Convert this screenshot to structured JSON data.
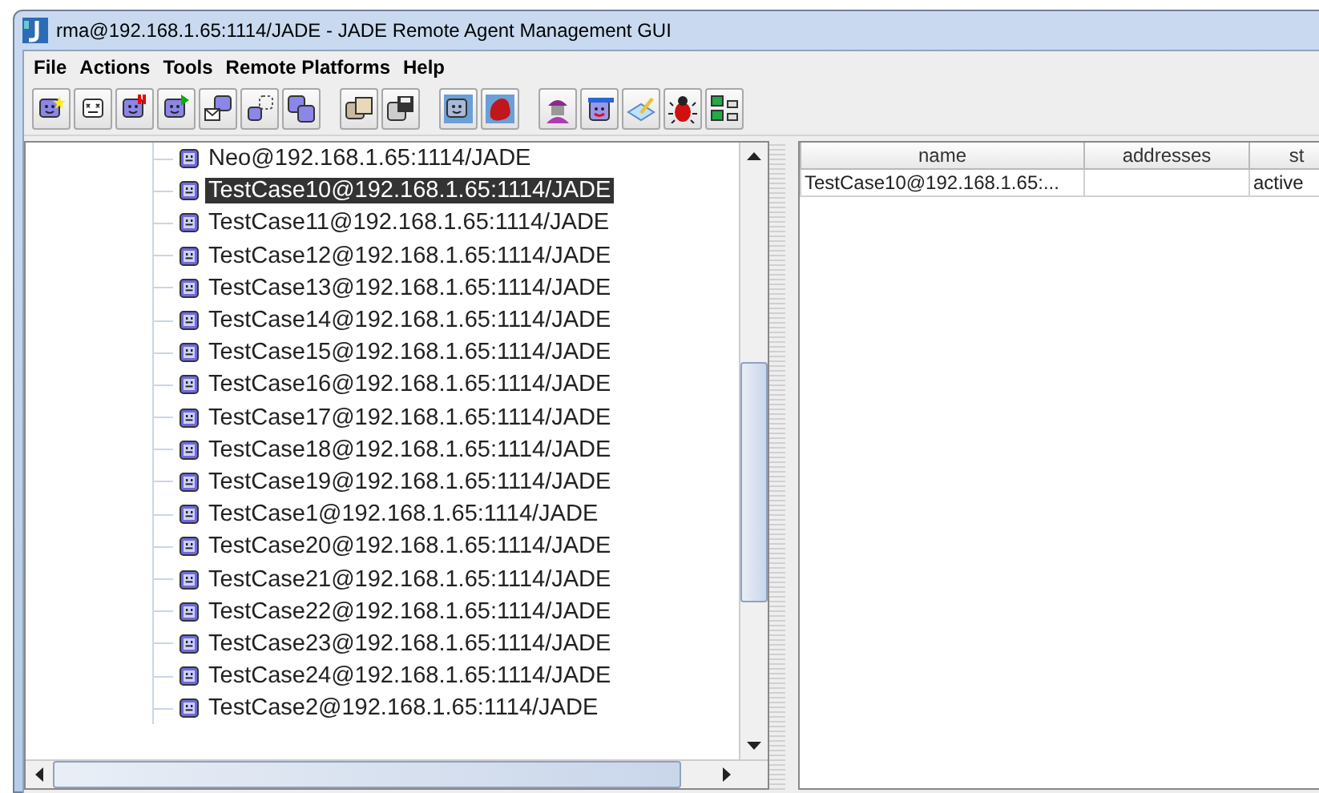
{
  "window": {
    "title": "rma@192.168.1.65:1114/JADE - JADE Remote Agent Management GUI"
  },
  "menu": [
    "File",
    "Actions",
    "Tools",
    "Remote Platforms",
    "Help"
  ],
  "toolbar": [
    [
      {
        "kind": "face-star"
      },
      {
        "kind": "face-dead"
      },
      {
        "kind": "face-pause"
      },
      {
        "kind": "face-play"
      },
      {
        "kind": "face-envelope"
      },
      {
        "kind": "face-dotted"
      },
      {
        "kind": "face-pair"
      }
    ],
    [
      {
        "kind": "faces-folder"
      },
      {
        "kind": "faces-disk"
      }
    ],
    [
      {
        "kind": "face-blue"
      },
      {
        "kind": "red-blob"
      }
    ],
    [
      {
        "kind": "spy"
      },
      {
        "kind": "face-cap"
      },
      {
        "kind": "notepad"
      },
      {
        "kind": "bug"
      },
      {
        "kind": "computers"
      }
    ]
  ],
  "tree": {
    "items": [
      {
        "label": "Neo@192.168.1.65:1114/JADE",
        "selected": false
      },
      {
        "label": "TestCase10@192.168.1.65:1114/JADE",
        "selected": true
      },
      {
        "label": "TestCase11@192.168.1.65:1114/JADE",
        "selected": false
      },
      {
        "label": "TestCase12@192.168.1.65:1114/JADE",
        "selected": false
      },
      {
        "label": "TestCase13@192.168.1.65:1114/JADE",
        "selected": false
      },
      {
        "label": "TestCase14@192.168.1.65:1114/JADE",
        "selected": false
      },
      {
        "label": "TestCase15@192.168.1.65:1114/JADE",
        "selected": false
      },
      {
        "label": "TestCase16@192.168.1.65:1114/JADE",
        "selected": false
      },
      {
        "label": "TestCase17@192.168.1.65:1114/JADE",
        "selected": false
      },
      {
        "label": "TestCase18@192.168.1.65:1114/JADE",
        "selected": false
      },
      {
        "label": "TestCase19@192.168.1.65:1114/JADE",
        "selected": false
      },
      {
        "label": "TestCase1@192.168.1.65:1114/JADE",
        "selected": false
      },
      {
        "label": "TestCase20@192.168.1.65:1114/JADE",
        "selected": false
      },
      {
        "label": "TestCase21@192.168.1.65:1114/JADE",
        "selected": false
      },
      {
        "label": "TestCase22@192.168.1.65:1114/JADE",
        "selected": false
      },
      {
        "label": "TestCase23@192.168.1.65:1114/JADE",
        "selected": false
      },
      {
        "label": "TestCase24@192.168.1.65:1114/JADE",
        "selected": false
      },
      {
        "label": "TestCase2@192.168.1.65:1114/JADE",
        "selected": false
      }
    ]
  },
  "table": {
    "columns": [
      "name",
      "addresses",
      "st"
    ],
    "rows": [
      {
        "cells": [
          "TestCase10@192.168.1.65:...",
          null,
          "active"
        ]
      }
    ]
  }
}
